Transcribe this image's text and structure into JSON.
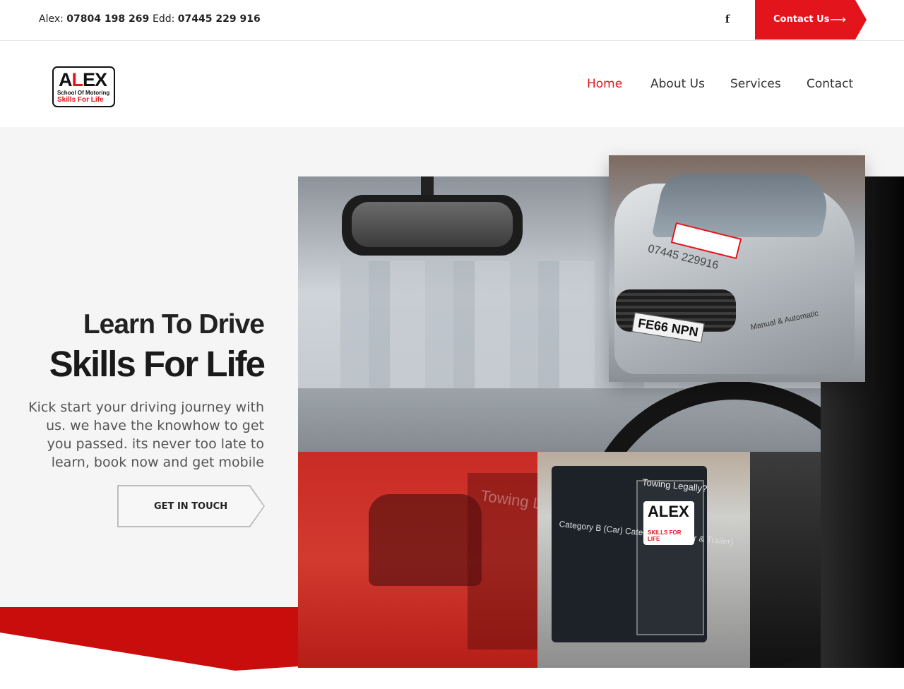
{
  "topbar": {
    "phones": [
      {
        "name": "Alex:",
        "number": "07804 198 269"
      },
      {
        "name": "Edd:",
        "number": "07445 229 916"
      }
    ],
    "social": {
      "icon": "facebook-icon",
      "glyph": "f"
    },
    "contact_button": {
      "label": "Contact Us",
      "arrow": "⟶"
    }
  },
  "header": {
    "logo": {
      "big_a": "A",
      "big_l": "L",
      "big_ex": "EX",
      "line1": "School Of Motoring",
      "line2": "Skills For Life"
    },
    "nav": [
      {
        "label": "Home",
        "active": true
      },
      {
        "label": "About Us",
        "active": false
      },
      {
        "label": "Services",
        "active": false
      },
      {
        "label": "Contact",
        "active": false
      }
    ]
  },
  "hero": {
    "title_line1": "Learn To Drive",
    "title_line2": "Skills For Life",
    "description": "Kick start your driving journey with us. we have the knowhow to get you passed. its never too late to learn, book now and get mobile",
    "cta_label": "GET IN TOUCH"
  },
  "photos": {
    "car_plate": "FE66 NPN",
    "car_phone": "07445 229916",
    "car_decal_line": "Manual & Automatic",
    "trailer_title": "Towing Legally?",
    "trailer_cat": "Category B (Car) Category B+E (Car & Trailer)",
    "trailer_logo_big": "ALEX",
    "trailer_logo_sub": "SKILLS FOR LIFE"
  },
  "colors": {
    "accent": "#e3141b",
    "band": "#c90c0c",
    "hero_bg": "#f5f5f5"
  }
}
